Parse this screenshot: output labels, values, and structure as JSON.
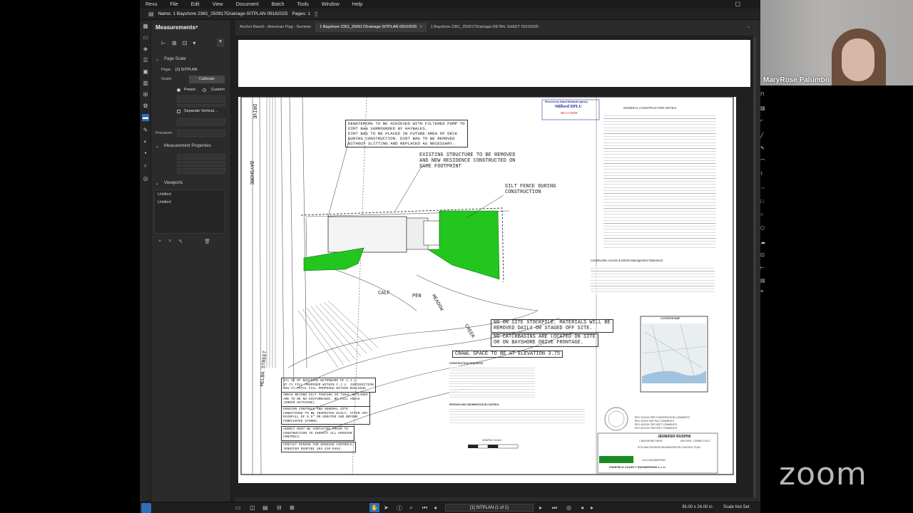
{
  "revu": {
    "menu": [
      "Revu",
      "File",
      "Edit",
      "View",
      "Document",
      "Batch",
      "Tools",
      "Window",
      "Help"
    ],
    "doc_name": "Name: 1 Bayshore 2361_250917Drainage-SITPLAN 09162025",
    "pages_label": "Pages: 1",
    "panel": {
      "title": "Measurements",
      "page_scale_label": "Page Scale",
      "page_label": "Page:",
      "page_value": "[1] SITPLAN",
      "scale_label": "Scale:",
      "calibrate_label": "Calibrate",
      "preset_label": "Preset",
      "custom_label": "Custom",
      "separate_vertical_label": "Separate Vertical...",
      "precision_label": "Precision:",
      "measurement_properties_label": "Measurement Properties",
      "viewports_label": "Viewports",
      "viewports": [
        "Untitled",
        "Untitled"
      ]
    },
    "tabs": [
      {
        "label": "Anchor Beach - American Flag - Summer",
        "active": false
      },
      {
        "label": "1 Bayshore 2361_250917Drainage-SITPLAN 09162025",
        "active": true
      },
      {
        "label": "1 Bayshore 2361_250917Drainage-DETAIL SHEET 09162025",
        "active": false
      }
    ],
    "status": {
      "page_indicator": "[1] SITPLAN (1 of 1)",
      "dimensions": "36.00 x 24.00 in",
      "scale": "Scale Not Set"
    }
  },
  "drawing": {
    "stamp_line1": "Received by Inland Wetlands Agency",
    "stamp_line2": "Milford DPLU",
    "stamp_line3": "09-17-2025",
    "notes": [
      "DEWATERING TO BE ACHIEVED WITH FILTERED PUMP TO\nDIRT BAG SURROUNDED BY HAYBALES.\nDIRT BAG TO BE PLACED IN FUTURE AREA OF DECK\nDURING CONSTRUCTION. DIRT BAG TO BE REMOVED\nWITHOUT SLITTING AND REPLACED AS NECESSARY.",
      "EXISTING STRUCTURE TO BE REMOVED\nAND NEW RESIDENCE CONSTRUCTED ON\nSAME FOOTPRINT",
      "SILT FENCE DURING\nCONSTRUCTION",
      "NO ON SITE STOCKPILE. MATERIALS WILL BE\nREMOVED DAILY OR STAGED OFF SITE.",
      "NO CATCHBASINS ARE LOCATED ON SITE\nOR ON BAYSHORE DRIVE FRONTAGE.",
      "CRAWL SPACE TO BE AT ELEVATION 3.75"
    ],
    "general_notes_title": "GENERAL CONSTRUCTION NOTES:",
    "access_title": "Construction Access & Debris Management Statement",
    "location_map_title": "LOCATION MAP",
    "streets": [
      "BAYSHORE",
      "DRIVE",
      "MELBA STREET",
      "CALF",
      "PEN",
      "MEADOW",
      "CREEK"
    ],
    "left_notes": [
      "47± SF OF BUILDING WATERWARD OF C.J.L.\n37 CY FILL PROPOSED WITHIN C.J.L. JURISDICTION\n105 CY TOTAL FILL PROPOSED WITHIN BUILDING",
      "AREAS BEYOND SILT FENCING IN TIDAL WETLANDS\nARE TO BE NO DISTURBANCE. NO FILL AREAS\n(GREEN HATCHING)",
      "EROSION CONTROLS AND GENERAL SITE\nCONDITIONS TO BE INSPECTED DAILY, AFTER ANY\nRAINFALL OF 0.5\" OR GREATER AND BEFORE\nFORECASTED STORMS.",
      "AGENCY MUST BE CONTACTED PRIOR TO\nCONSTRUCTION TO INSPECT ALL EROSION\nCONTROLS.",
      "CONTACT PERSON FOR EROSION CONTROLS:\nJENNIFER RUSPINI 203 410-9484"
    ],
    "sequence_title": "CONSTRUCTION SEQUENCE",
    "sediment_title": "EROSION AND SEDIMENTATION CONTROL",
    "graphic_scale": "GRAPHIC SCALE",
    "title_block": {
      "name": "JENNIFER RUSPINI",
      "address": "1 BAYSHORE DRIVE",
      "town": "MILFORD, CONNECTICUT",
      "sheet_title": "SITE AND EROSION SEDIMENTATION CONTROL PLAN",
      "discipline": "CIVIL ENGINEERING",
      "firm": "FAIRFIELD COUNTY ENGINEERING L.L.C.",
      "revisions": [
        "REV. 9/15/25: PER CONSERVATION COMMENTS",
        "REV. 9/2/25: PER P&Z COMMENTS",
        "REV. 8/20/25: PER DEPT COMMENTS",
        "REV. 8/11/25: PER DEPT COMMENTS"
      ]
    }
  },
  "participant": {
    "name": "MaryRose Palumbo"
  },
  "zoom_logo": "zoom",
  "colors": {
    "accent": "#2d6fb6",
    "wetland_green": "#22c61e",
    "panel_bg": "#2b2b2b"
  }
}
